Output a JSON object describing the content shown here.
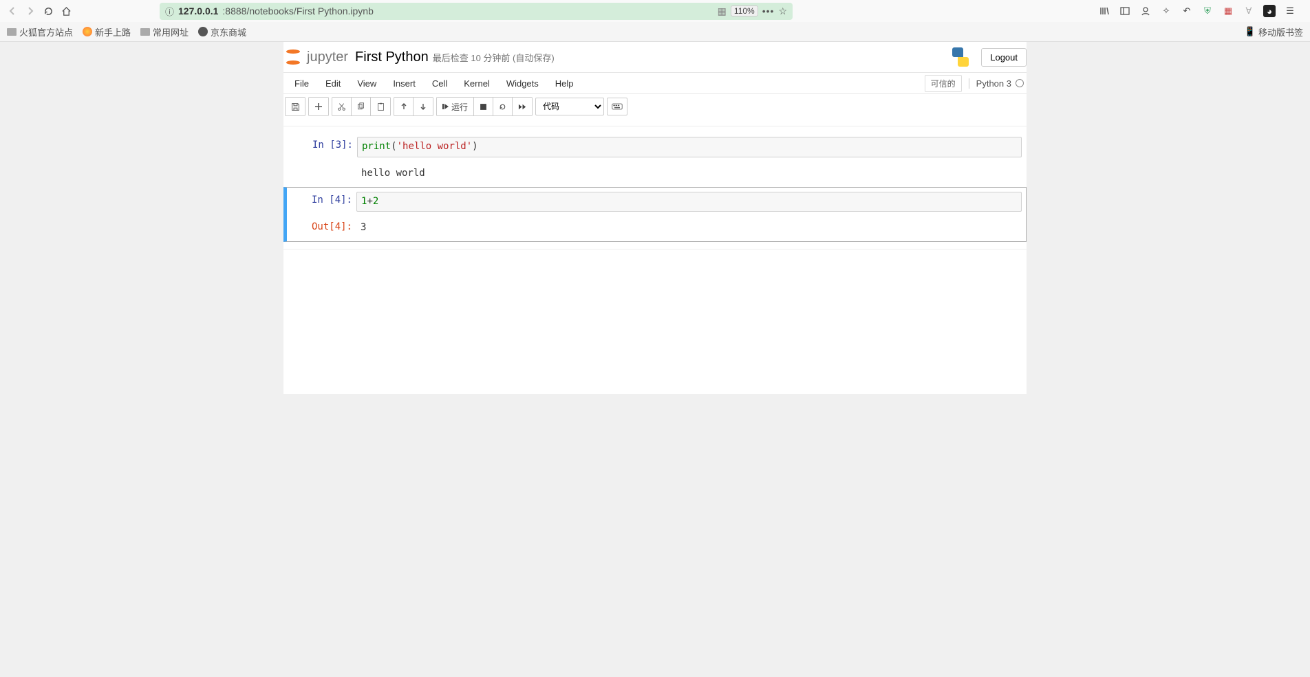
{
  "browser": {
    "url_host": "127.0.0.1",
    "url_port_path": ":8888/notebooks/First Python.ipynb",
    "zoom": "110%"
  },
  "bookmarks": {
    "items": [
      "火狐官方站点",
      "新手上路",
      "常用网址",
      "京东商城"
    ],
    "right": "移动版书签"
  },
  "header": {
    "logo_text": "jupyter",
    "title": "First Python",
    "checkpoint": "最后检查  10 分钟前  (自动保存)",
    "logout": "Logout"
  },
  "menu": {
    "items": [
      "File",
      "Edit",
      "View",
      "Insert",
      "Cell",
      "Kernel",
      "Widgets",
      "Help"
    ],
    "trusted": "可信的",
    "kernel": "Python 3"
  },
  "toolbar": {
    "run_label": "运行",
    "celltype": "代码"
  },
  "notebook": {
    "cells": [
      {
        "in_prompt": "In  [3]:",
        "code_builtin": "print",
        "code_paren_open": "(",
        "code_string": "'hello world'",
        "code_paren_close": ")",
        "stdout": "hello world"
      },
      {
        "in_prompt": "In  [4]:",
        "code_num1": "1",
        "code_op": "+",
        "code_num2": "2",
        "out_prompt": "Out[4]:",
        "out_value": "3"
      }
    ]
  }
}
